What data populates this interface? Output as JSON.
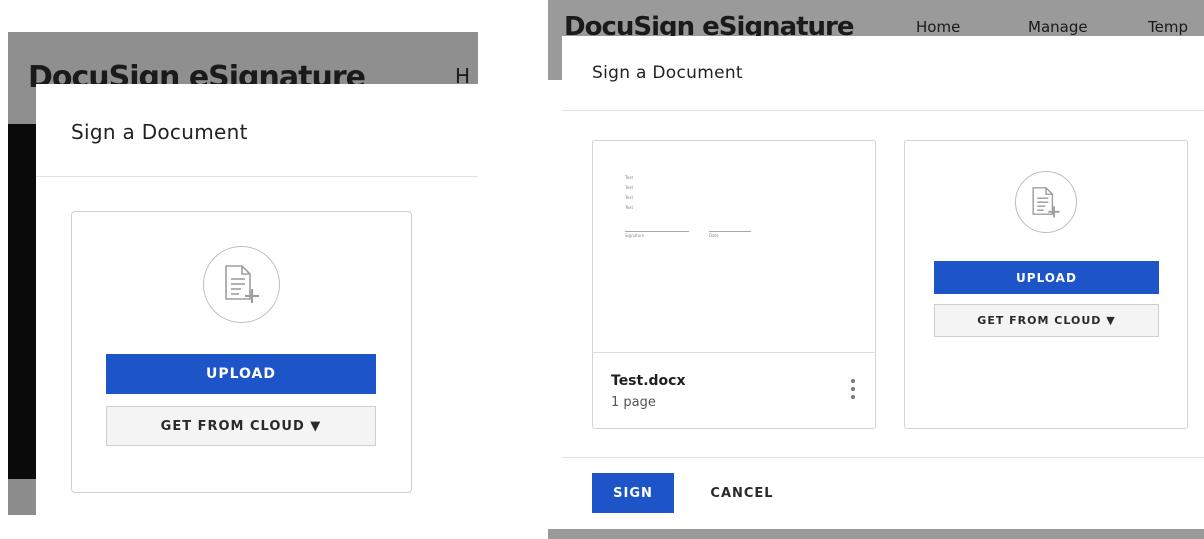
{
  "left": {
    "brand": "DocuSign eSignature",
    "nav_peek": "H",
    "modal": {
      "title": "Sign a Document",
      "upload_label": "UPLOAD",
      "cloud_label": "GET FROM CLOUD ▼",
      "icon": "document-add-icon"
    }
  },
  "right": {
    "brand": "DocuSign eSignature",
    "nav": [
      "Home",
      "Manage",
      "Temp"
    ],
    "modal": {
      "title": "Sign a Document",
      "file": {
        "name": "Test.docx",
        "pages": "1 page",
        "thumbnail_lines": [
          "Text",
          "Text",
          "Text",
          "Text"
        ],
        "thumbnail_signature": "Signature",
        "thumbnail_date": "Date"
      },
      "upload_label": "UPLOAD",
      "cloud_label": "GET FROM CLOUD ▼",
      "icon": "document-add-icon",
      "sign_label": "SIGN",
      "cancel_label": "CANCEL"
    }
  },
  "colors": {
    "primary": "#1d55c8",
    "overlay": "#9a9a9a",
    "border": "#d4d4d4"
  }
}
